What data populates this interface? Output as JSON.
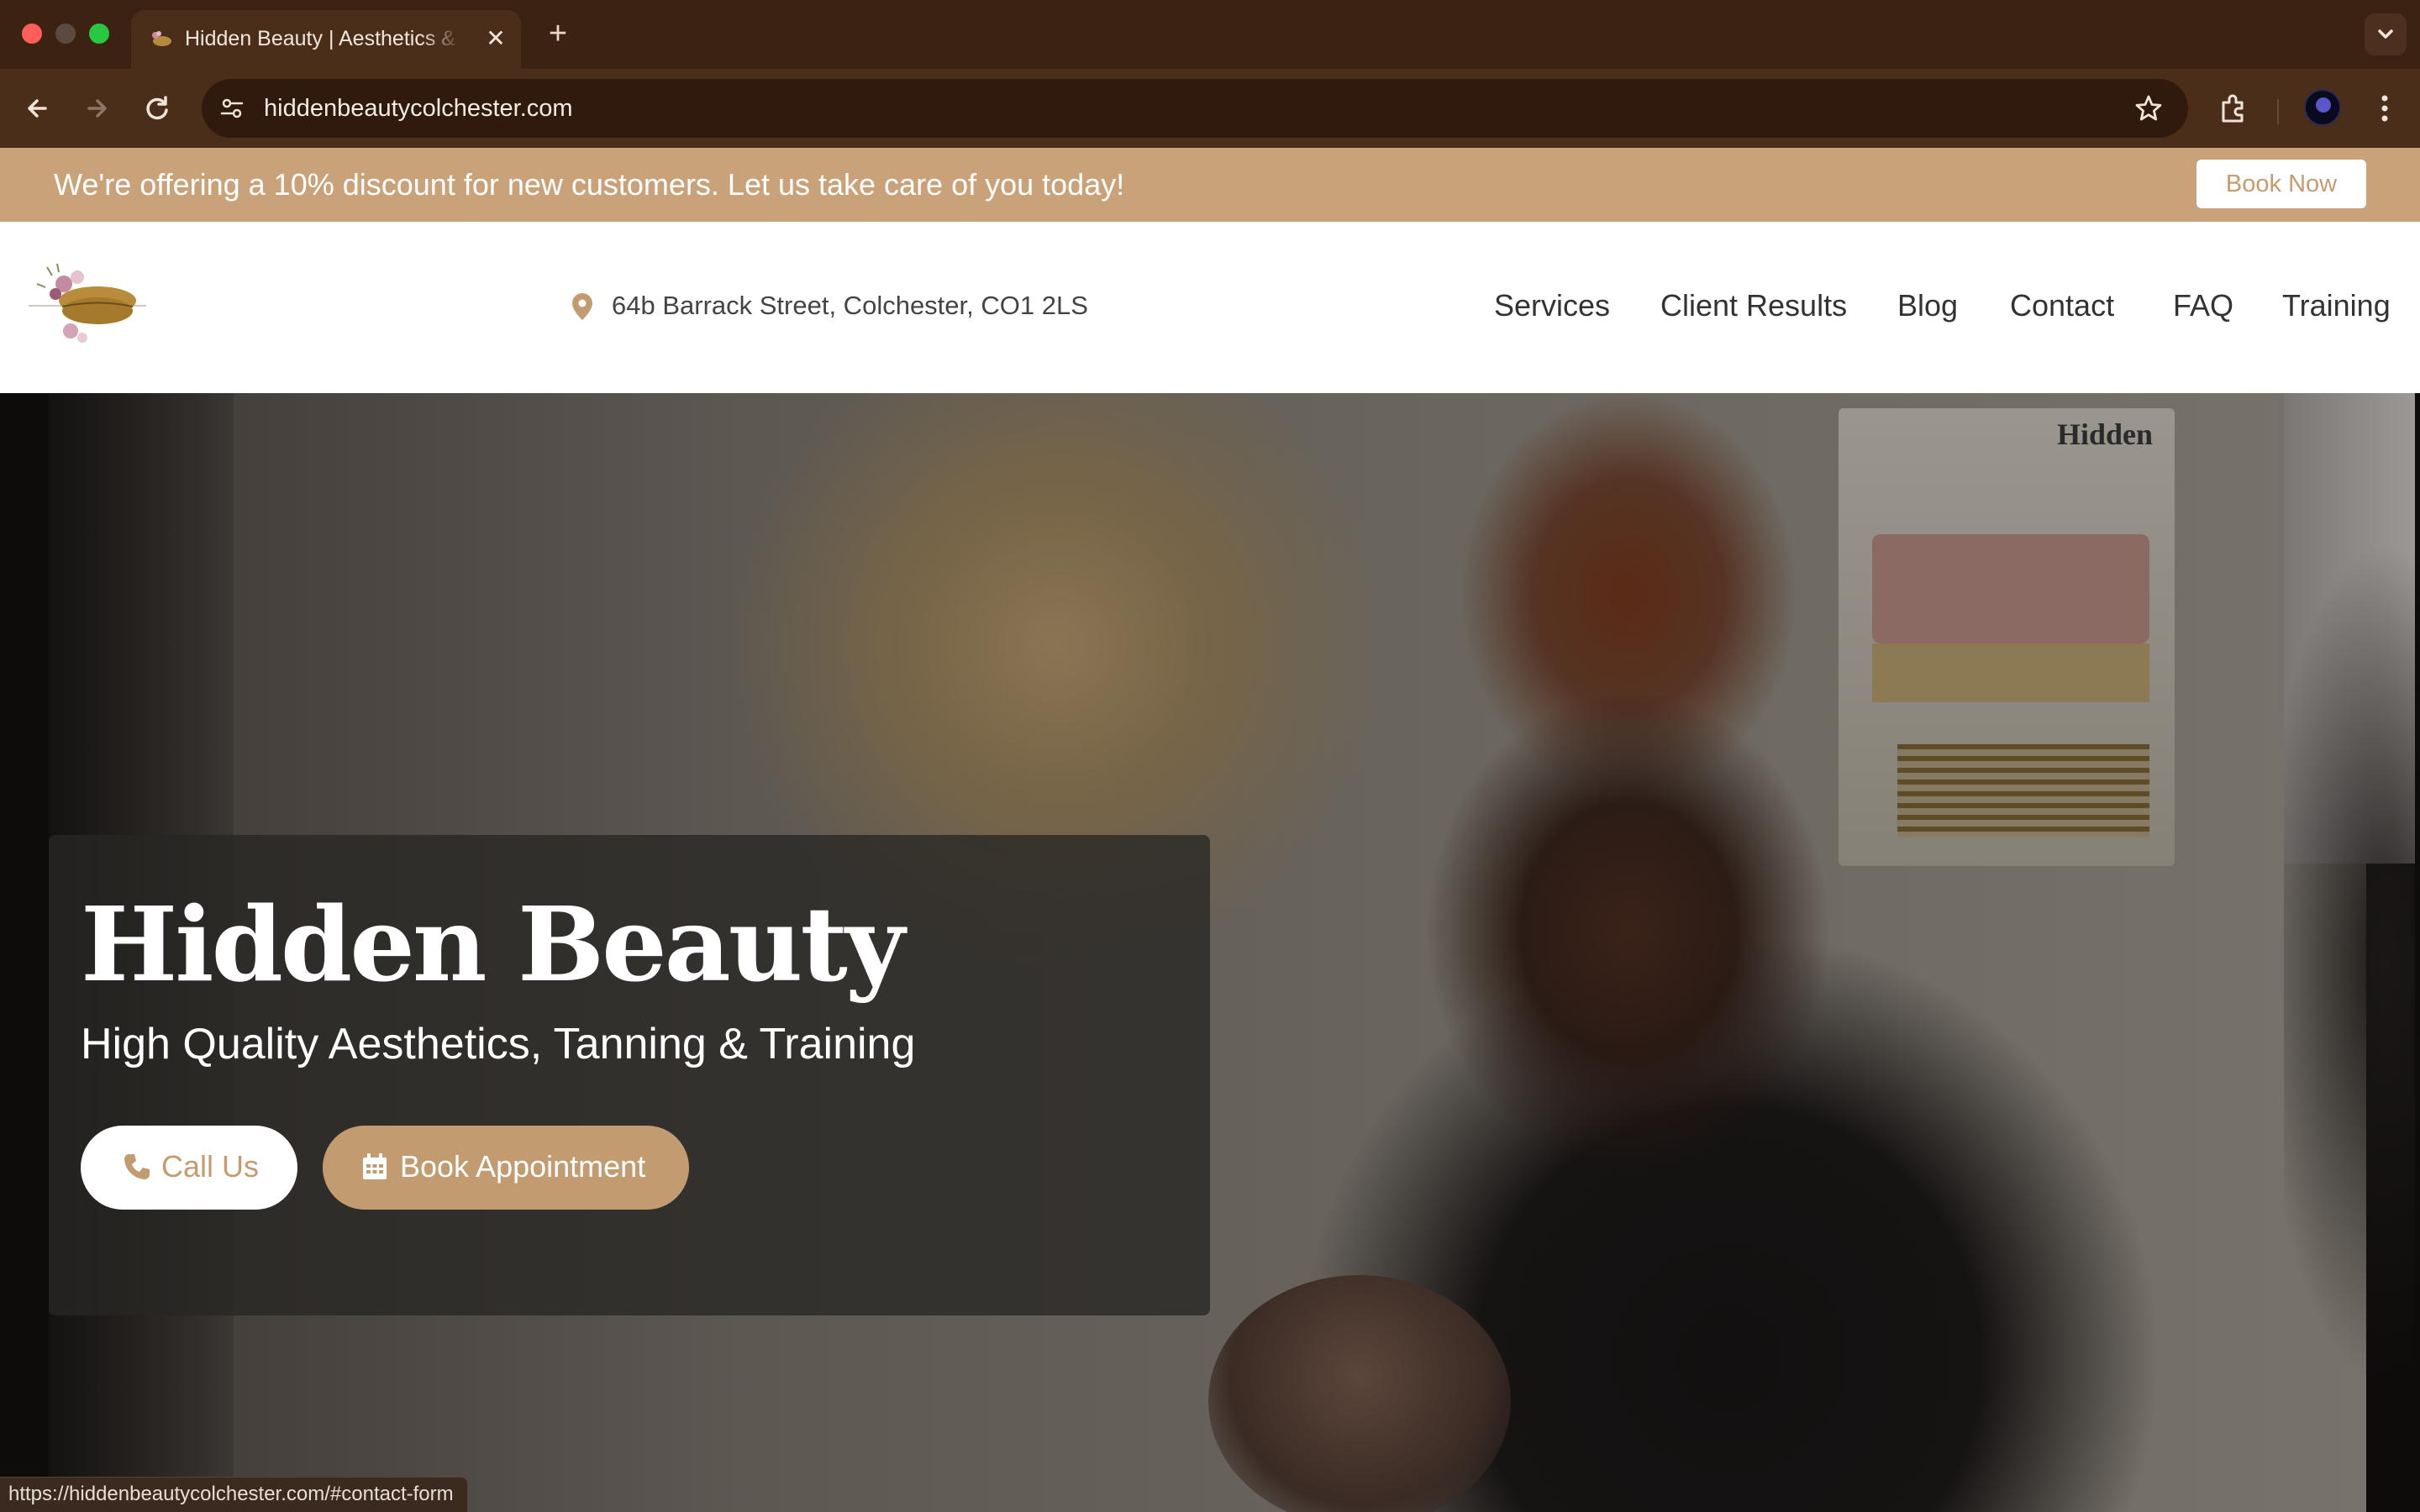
{
  "browser": {
    "tab_title": "Hidden Beauty | Aesthetics & Tanning",
    "tab_close_glyph": "✕",
    "new_tab_glyph": "+",
    "url": "hiddenbeautycolchester.com",
    "status_url": "https://hiddenbeautycolchester.com/#contact-form",
    "traffic_colors": [
      "#ff5f57",
      "#5b4a3f",
      "#28c840"
    ]
  },
  "promo": {
    "text": "We're offering a 10% discount for new customers. Let us take care of you today!",
    "button_label": "Book Now"
  },
  "header": {
    "address": "64b Barrack Street, Colchester, CO1 2LS",
    "nav": [
      "Services",
      "Client Results",
      "Blog",
      "Contact",
      "FAQ",
      "Training"
    ]
  },
  "hero": {
    "title": "Hidden Beauty",
    "subtitle": "High Quality Aesthetics, Tanning & Training",
    "call_label": "Call Us",
    "book_label": "Book Appointment",
    "chart_text": "Hidden"
  },
  "colors": {
    "accent": "#c39b70",
    "promo_bg": "#caa27a",
    "chrome_dark": "#3b2213"
  }
}
